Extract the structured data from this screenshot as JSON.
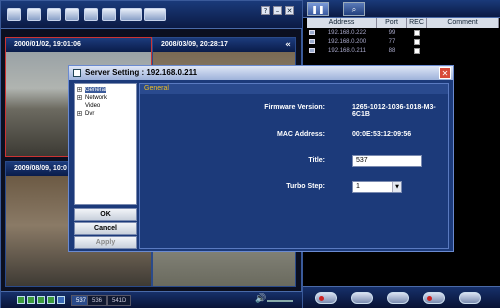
{
  "viewer": {
    "window_controls": [
      "?",
      "–",
      "✕"
    ],
    "cameras": [
      {
        "timestamp": "2000/01/02, 19:01:06"
      },
      {
        "timestamp": "2008/03/09, 20:28:17"
      },
      {
        "timestamp": "2009/08/09, 10:0"
      }
    ],
    "collapse_glyph": "«",
    "bottom_numbers": [
      "537",
      "536",
      "541D"
    ]
  },
  "rpanel": {
    "columns": [
      "Address",
      "Port",
      "REC",
      "Comment"
    ],
    "rows": [
      {
        "address": "192.168.0.222",
        "port": "99"
      },
      {
        "address": "192.168.0.200",
        "port": "77"
      },
      {
        "address": "192.168.0.211",
        "port": "88"
      }
    ]
  },
  "dialog": {
    "title": "Server Setting : 192.168.0.211",
    "close_glyph": "✕",
    "tree": [
      {
        "label": "General",
        "expander": "+"
      },
      {
        "label": "Network",
        "expander": "+"
      },
      {
        "label": "Video",
        "expander": ""
      },
      {
        "label": "Dvr",
        "expander": "+"
      }
    ],
    "buttons": {
      "ok": "OK",
      "cancel": "Cancel",
      "apply": "Apply"
    },
    "section": "General",
    "firmware_label": "Firmware Version:",
    "firmware_value": "1265-1012-1036-1018-M3-6C1B",
    "mac_label": "MAC Address:",
    "mac_value": "00:0E:53:12:09:56",
    "title_label": "Title:",
    "title_value": "537",
    "turbo_label": "Turbo Step:",
    "turbo_value": "1"
  }
}
